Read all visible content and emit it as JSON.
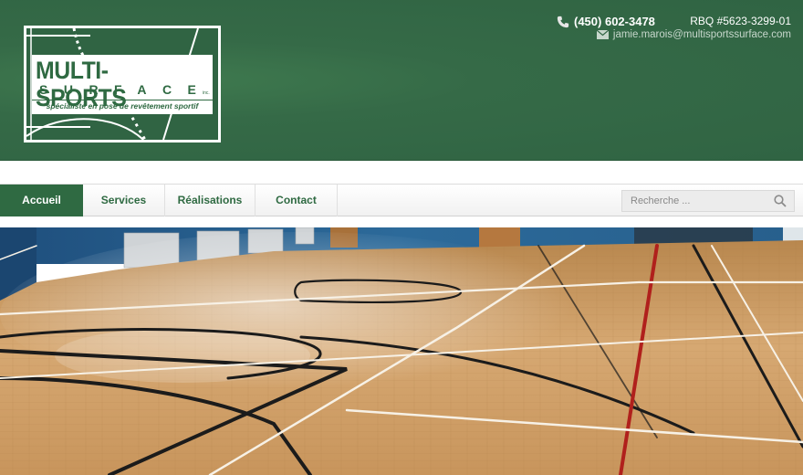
{
  "brand": {
    "name": "MULTI-SPORTS",
    "sub": "SURFACE",
    "inc": "inc.",
    "tagline": "spécialiste en pose de revêtement sportif"
  },
  "contact": {
    "phone": "(450) 602-3478",
    "rbq": "RBQ #5623-3299-01",
    "email": "jamie.marois@multisportssurface.com"
  },
  "nav": {
    "items": [
      {
        "label": "Accueil",
        "active": true
      },
      {
        "label": "Services",
        "active": false
      },
      {
        "label": "Réalisations",
        "active": false
      },
      {
        "label": "Contact",
        "active": false
      }
    ]
  },
  "search": {
    "placeholder": "Recherche ..."
  },
  "icons": {
    "phone": "phone-icon",
    "email": "envelope-icon",
    "search": "search-icon"
  },
  "colors": {
    "brand_green": "#306443",
    "nav_text": "#2f6a42",
    "white": "#ffffff"
  }
}
